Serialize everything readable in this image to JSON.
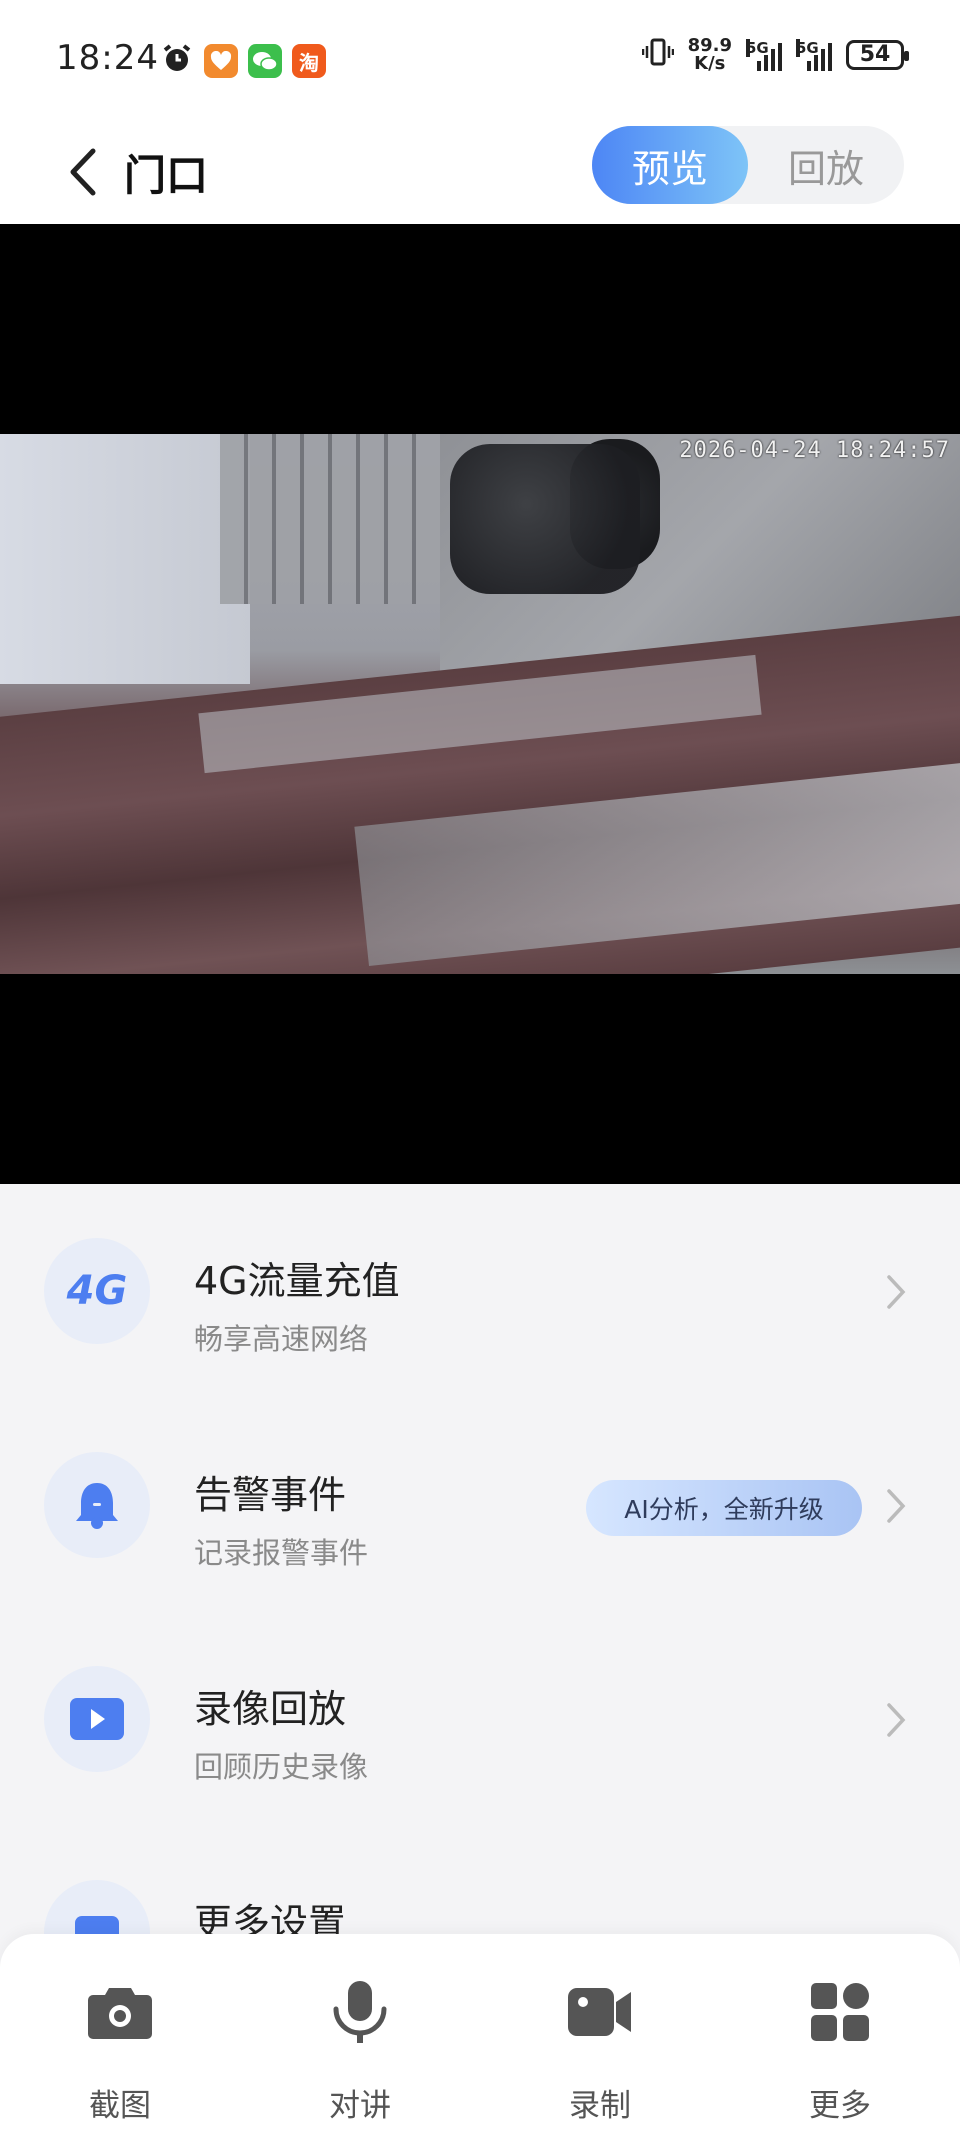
{
  "status_bar": {
    "time": "18:24",
    "net_speed_value": "89.9",
    "net_speed_unit": "K/s",
    "signal1_label": "5G",
    "signal2_label": "5G",
    "battery": "54",
    "app_badge_taobao": "淘"
  },
  "header": {
    "title": "门口",
    "tabs": [
      "预览",
      "回放"
    ],
    "active_tab": "预览"
  },
  "video": {
    "timestamp": "2026-04-24 18:24:57"
  },
  "menu": {
    "items": [
      {
        "icon_text": "4G",
        "title": "4G流量充值",
        "subtitle": "畅享高速网络"
      },
      {
        "title": "告警事件",
        "subtitle": "记录报警事件",
        "badge": "AI分析，全新升级"
      },
      {
        "title": "录像回放",
        "subtitle": "回顾历史录像"
      },
      {
        "title": "更多设置"
      }
    ]
  },
  "toolbar": {
    "items": [
      {
        "label": "截图",
        "icon": "camera-icon"
      },
      {
        "label": "对讲",
        "icon": "microphone-icon"
      },
      {
        "label": "录制",
        "icon": "video-camera-icon"
      },
      {
        "label": "更多",
        "icon": "grid-icon"
      }
    ]
  },
  "colors": {
    "accent": "#4d86f5",
    "icon_blue": "#4d7ef0",
    "icon_bg": "#e8edf8"
  }
}
